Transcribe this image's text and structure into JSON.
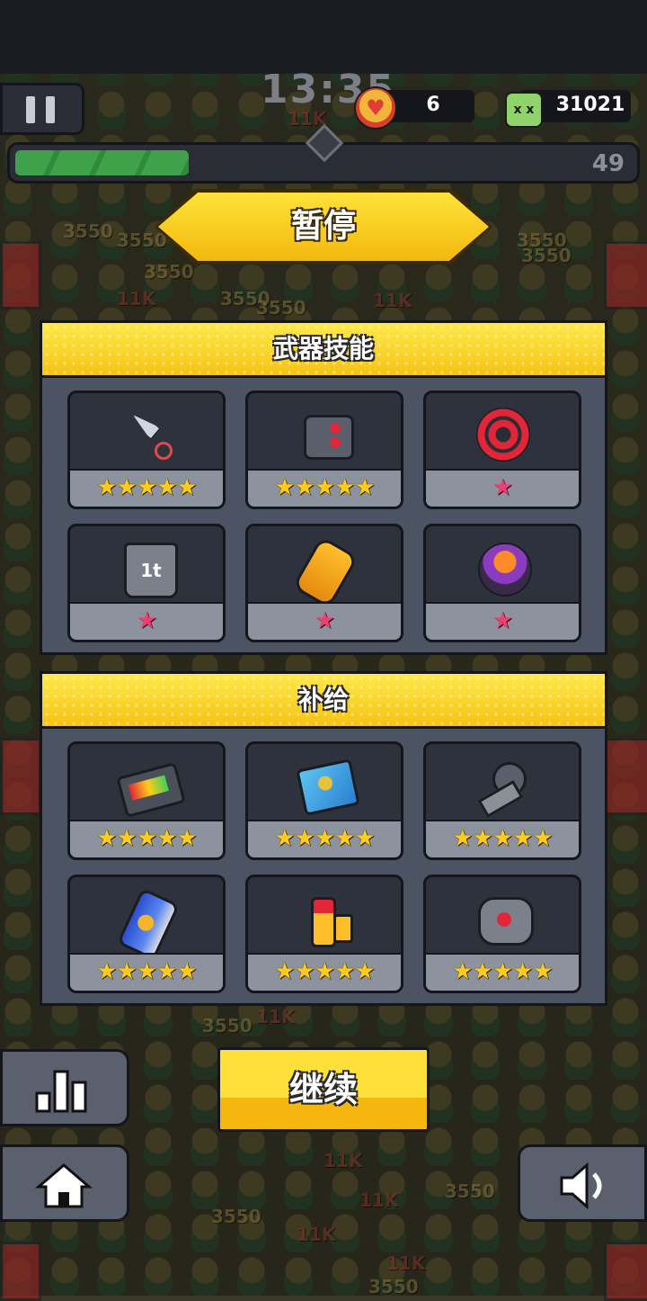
{
  "hud": {
    "timer": "13:35",
    "lives": "6",
    "kills": "31021",
    "level": "49",
    "xp_progress_percent": 28
  },
  "pause_title": "暂停",
  "weapons": {
    "header": "武器技能",
    "items": [
      {
        "icon": "kunai-icon",
        "stars": "★★★★★",
        "star_color": "gold"
      },
      {
        "icon": "robot-head-icon",
        "stars": "★★★★★",
        "star_color": "gold"
      },
      {
        "icon": "sawblade-icon",
        "stars": "★",
        "star_color": "pink"
      },
      {
        "icon": "weight-1t-icon",
        "label": "1t",
        "stars": "★",
        "star_color": "pink"
      },
      {
        "icon": "energy-capsule-icon",
        "stars": "★",
        "star_color": "pink"
      },
      {
        "icon": "orb-launcher-icon",
        "stars": "★",
        "star_color": "pink"
      }
    ]
  },
  "supplies": {
    "header": "补给",
    "items": [
      {
        "icon": "battery-pack-icon",
        "stars": "★★★★★",
        "star_color": "gold"
      },
      {
        "icon": "book-icon",
        "stars": "★★★★★",
        "star_color": "gold"
      },
      {
        "icon": "mechanical-arm-icon",
        "stars": "★★★★★",
        "star_color": "gold"
      },
      {
        "icon": "energy-can-icon",
        "stars": "★★★★★",
        "star_color": "gold"
      },
      {
        "icon": "battery-cell-icon",
        "stars": "★★★★★",
        "star_color": "gold"
      },
      {
        "icon": "magnet-icon",
        "stars": "★★★★★",
        "star_color": "gold"
      }
    ]
  },
  "continue_label": "继续",
  "colors": {
    "gold_star": "#ffcc1a",
    "pink_star": "#ef3f6e",
    "banner_yellow": "#ffe23a",
    "panel_bg": "#4c5363"
  }
}
